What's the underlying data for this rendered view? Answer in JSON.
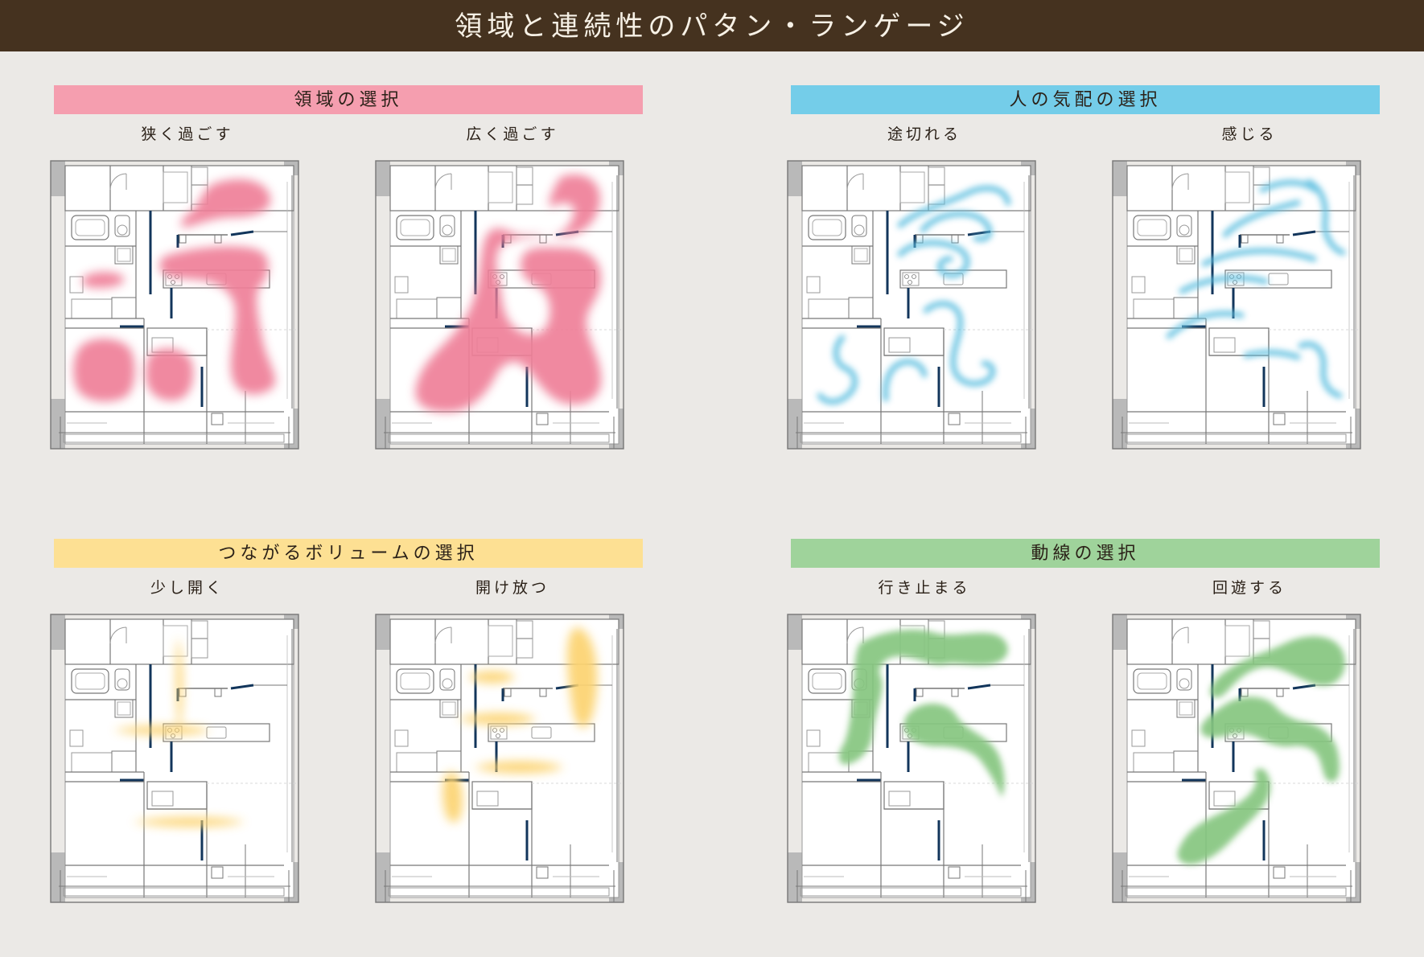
{
  "header": {
    "title": "領域と連続性のパタン・ランゲージ",
    "bg_color": "#45321f",
    "text_color": "#f7f1e6"
  },
  "groups": [
    {
      "title": "領域の選択",
      "color": "#f59eaf",
      "mark_color": "#ef7f98",
      "style": "blob",
      "plans": [
        {
          "label": "狭く過ごす"
        },
        {
          "label": "広く過ごす"
        }
      ]
    },
    {
      "title": "人の気配の選択",
      "color": "#74cde9",
      "mark_color": "#5fbfe0",
      "style": "stroke",
      "plans": [
        {
          "label": "途切れる"
        },
        {
          "label": "感じる"
        }
      ]
    },
    {
      "title": "つながるボリュームの選択",
      "color": "#fde093",
      "mark_color": "#fcd36f",
      "style": "blob",
      "plans": [
        {
          "label": "少し開く"
        },
        {
          "label": "開け放つ"
        }
      ]
    },
    {
      "title": "動線の選択",
      "color": "#9fd39b",
      "mark_color": "#86c680",
      "style": "stroke",
      "plans": [
        {
          "label": "行き止まる"
        },
        {
          "label": "回遊する"
        }
      ]
    }
  ]
}
